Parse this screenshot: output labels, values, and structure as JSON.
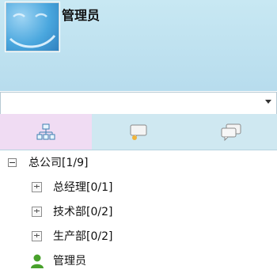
{
  "header": {
    "username": "管理员"
  },
  "org_select": {
    "value": ""
  },
  "tabs": [
    {
      "name": "organization-tab",
      "icon": "org-tree-icon",
      "active": true
    },
    {
      "name": "chat-tab",
      "icon": "chat-bubble-icon",
      "active": false
    },
    {
      "name": "group-chat-tab",
      "icon": "group-chat-icon",
      "active": false
    }
  ],
  "tree": {
    "root_label": "总公司[1/9]",
    "children": [
      {
        "label": "总经理[0/1]"
      },
      {
        "label": "技术部[0/2]"
      },
      {
        "label": "生产部[0/2]"
      }
    ],
    "user_label": "管理员"
  },
  "colors": {
    "header_bg": "#c8e8f3",
    "active_tab_bg": "#f0dcf3",
    "user_icon_green": "#48a12b"
  }
}
